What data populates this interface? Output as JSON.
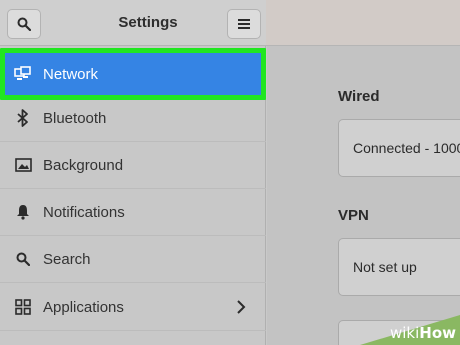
{
  "header": {
    "title": "Settings",
    "search_icon": "search-icon",
    "menu_icon": "hamburger-menu-icon"
  },
  "sidebar": {
    "items": [
      {
        "label": "Network",
        "icon": "network-icon",
        "active": true
      },
      {
        "label": "Bluetooth",
        "icon": "bluetooth-icon"
      },
      {
        "label": "Background",
        "icon": "image-icon"
      },
      {
        "label": "Notifications",
        "icon": "bell-icon"
      },
      {
        "label": "Search",
        "icon": "search-icon"
      },
      {
        "label": "Applications",
        "icon": "grid-icon",
        "has_submenu": true
      }
    ]
  },
  "main": {
    "wired_title": "Wired",
    "wired_status": "Connected - 1000",
    "vpn_title": "VPN",
    "vpn_status": "Not set up"
  },
  "watermark": {
    "text_light": "wiki",
    "text_bold": "How"
  },
  "colors": {
    "accent": "#3584e4",
    "highlight_border": "#21e621"
  }
}
